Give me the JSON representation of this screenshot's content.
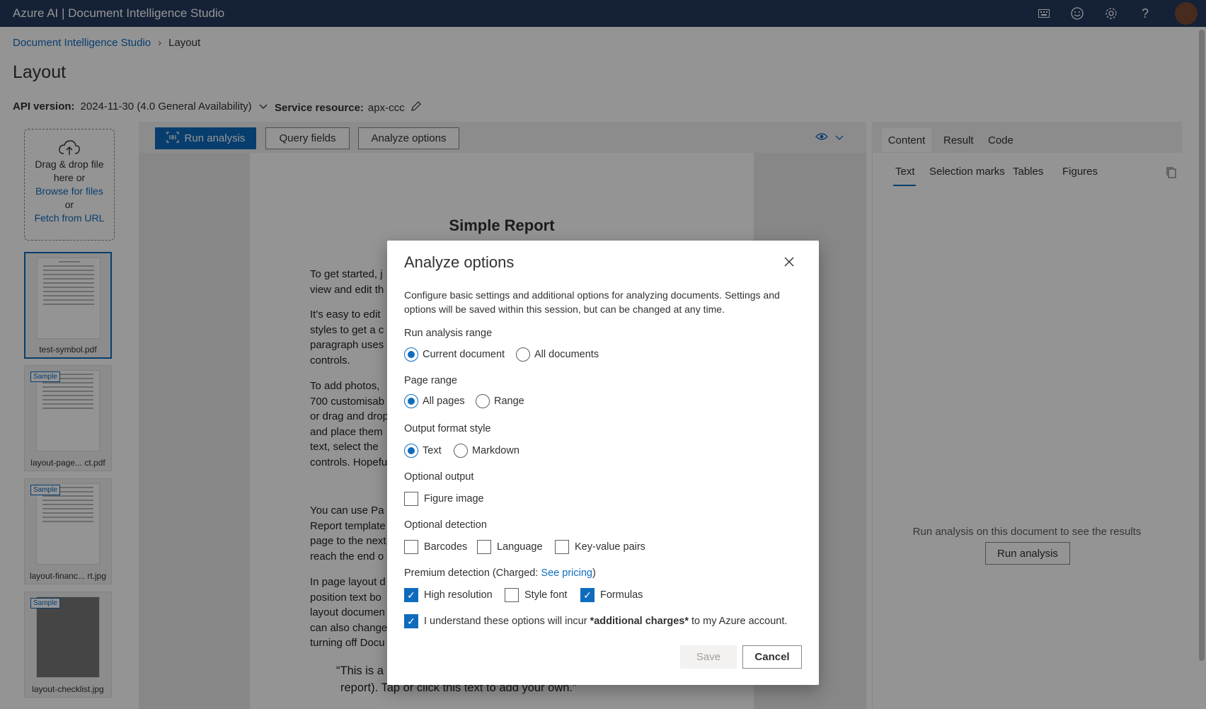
{
  "app": {
    "title": "Azure AI | Document Intelligence Studio"
  },
  "breadcrumb": {
    "home": "Document Intelligence Studio",
    "current": "Layout"
  },
  "page": {
    "title": "Layout"
  },
  "api": {
    "label": "API version:",
    "value": "2024-11-30 (4.0 General Availability)"
  },
  "service": {
    "label": "Service resource:",
    "value": "apx-ccc"
  },
  "upload": {
    "line1": "Drag & drop file",
    "line2": "here or",
    "browse": "Browse for files",
    "or": "or",
    "fetch": "Fetch from URL"
  },
  "files": [
    {
      "name": "test-symbol.pdf",
      "tag": ""
    },
    {
      "name": "layout-page... ct.pdf",
      "tag": "Sample"
    },
    {
      "name": "layout-financ... rt.jpg",
      "tag": "Sample"
    },
    {
      "name": "layout-checklist.jpg",
      "tag": "Sample"
    }
  ],
  "toolbar": {
    "run": "Run analysis",
    "query": "Query fields",
    "options": "Analyze options"
  },
  "document": {
    "title": "Simple Report",
    "p1": [
      "To get started, j",
      "view and edit th"
    ],
    "p2": [
      "It's easy to edit",
      "styles to get a c",
      "paragraph uses",
      "controls."
    ],
    "p3": [
      "To add photos,",
      "700 customisab",
      "or drag and drop",
      "and place them",
      "text, select the",
      "controls. Hopefu"
    ],
    "p4": [
      "You can use Pa",
      "Report template",
      "page to the next",
      "reach the end o"
    ],
    "p5": [
      "In page layout d",
      "position text bo",
      "layout documen",
      "can also change",
      "turning off Docu"
    ],
    "quote1": "“This is a",
    "quote2": "report). Tap or click this text to add your own.”"
  },
  "right_panel": {
    "tabs": [
      "Content",
      "Result",
      "Code"
    ],
    "subtabs": [
      "Text",
      "Selection marks",
      "Tables",
      "Figures"
    ],
    "empty": "Run analysis on this document to see the results",
    "run": "Run analysis"
  },
  "dialog": {
    "title": "Analyze options",
    "description": "Configure basic settings and additional options for analyzing documents. Settings and options will be saved within this session, but can be changed at any time.",
    "run_range": {
      "label": "Run analysis range",
      "opt1": "Current document",
      "opt2": "All documents",
      "selected": "Current document"
    },
    "page_range": {
      "label": "Page range",
      "opt1": "All pages",
      "opt2": "Range",
      "selected": "All pages"
    },
    "output_format": {
      "label": "Output format style",
      "opt1": "Text",
      "opt2": "Markdown",
      "selected": "Text"
    },
    "optional_output": {
      "label": "Optional output",
      "figure": "Figure image",
      "figure_checked": false
    },
    "optional_detection": {
      "label": "Optional detection",
      "barcodes": "Barcodes",
      "language": "Language",
      "kv": "Key-value pairs"
    },
    "premium": {
      "label": "Premium detection (Charged: ",
      "link": "See pricing",
      "close": ")",
      "high_res": "High resolution",
      "high_res_checked": true,
      "style_font": "Style font",
      "style_font_checked": false,
      "formulas": "Formulas",
      "formulas_checked": true
    },
    "consent": {
      "pre": "I understand these options will incur ",
      "bold": "*additional charges*",
      "post": " to my Azure account.",
      "checked": true
    },
    "save": "Save",
    "cancel": "Cancel"
  }
}
